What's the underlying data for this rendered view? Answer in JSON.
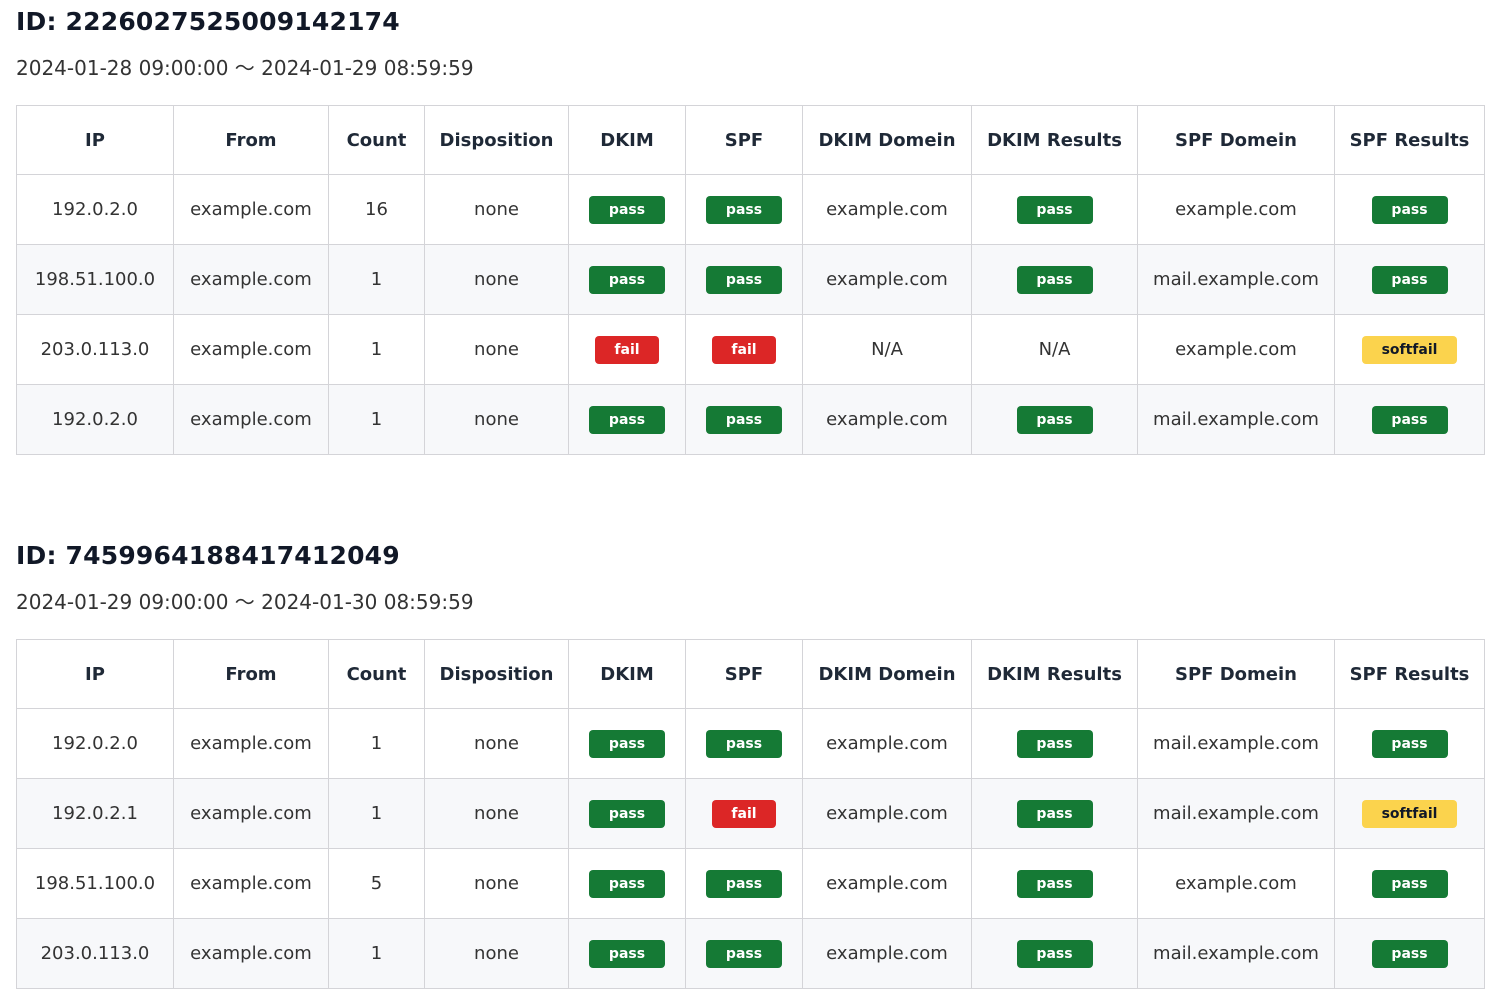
{
  "columns": [
    "IP",
    "From",
    "Count",
    "Disposition",
    "DKIM",
    "SPF",
    "DKIM Domein",
    "DKIM Results",
    "SPF Domein",
    "SPF Results"
  ],
  "colors": {
    "pass": "#157a35",
    "fail": "#dc2626",
    "softfail": "#fbd34d"
  },
  "reports": [
    {
      "title": "ID: 2226027525009142174",
      "period": "2024-01-28 09:00:00 〜 2024-01-29 08:59:59",
      "rows": [
        {
          "ip": "192.0.2.0",
          "from": "example.com",
          "count": "16",
          "disposition": "none",
          "dkim": "pass",
          "spf": "pass",
          "dkim_domain": "example.com",
          "dkim_result": "pass",
          "spf_domain": "example.com",
          "spf_result": "pass"
        },
        {
          "ip": "198.51.100.0",
          "from": "example.com",
          "count": "1",
          "disposition": "none",
          "dkim": "pass",
          "spf": "pass",
          "dkim_domain": "example.com",
          "dkim_result": "pass",
          "spf_domain": "mail.example.com",
          "spf_result": "pass"
        },
        {
          "ip": "203.0.113.0",
          "from": "example.com",
          "count": "1",
          "disposition": "none",
          "dkim": "fail",
          "spf": "fail",
          "dkim_domain": "N/A",
          "dkim_result": "N/A",
          "spf_domain": "example.com",
          "spf_result": "softfail"
        },
        {
          "ip": "192.0.2.0",
          "from": "example.com",
          "count": "1",
          "disposition": "none",
          "dkim": "pass",
          "spf": "pass",
          "dkim_domain": "example.com",
          "dkim_result": "pass",
          "spf_domain": "mail.example.com",
          "spf_result": "pass"
        }
      ]
    },
    {
      "title": "ID: 7459964188417412049",
      "period": "2024-01-29 09:00:00 〜 2024-01-30 08:59:59",
      "rows": [
        {
          "ip": "192.0.2.0",
          "from": "example.com",
          "count": "1",
          "disposition": "none",
          "dkim": "pass",
          "spf": "pass",
          "dkim_domain": "example.com",
          "dkim_result": "pass",
          "spf_domain": "mail.example.com",
          "spf_result": "pass"
        },
        {
          "ip": "192.0.2.1",
          "from": "example.com",
          "count": "1",
          "disposition": "none",
          "dkim": "pass",
          "spf": "fail",
          "dkim_domain": "example.com",
          "dkim_result": "pass",
          "spf_domain": "mail.example.com",
          "spf_result": "softfail"
        },
        {
          "ip": "198.51.100.0",
          "from": "example.com",
          "count": "5",
          "disposition": "none",
          "dkim": "pass",
          "spf": "pass",
          "dkim_domain": "example.com",
          "dkim_result": "pass",
          "spf_domain": "example.com",
          "spf_result": "pass"
        },
        {
          "ip": "203.0.113.0",
          "from": "example.com",
          "count": "1",
          "disposition": "none",
          "dkim": "pass",
          "spf": "pass",
          "dkim_domain": "example.com",
          "dkim_result": "pass",
          "spf_domain": "mail.example.com",
          "spf_result": "pass"
        }
      ]
    }
  ]
}
